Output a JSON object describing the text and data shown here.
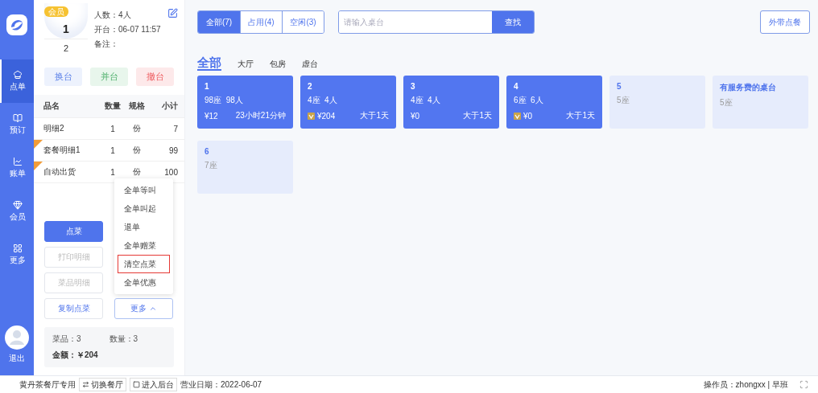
{
  "sidebar": {
    "items": [
      {
        "label": "点单",
        "kind": "order",
        "selected": true
      },
      {
        "label": "预订",
        "kind": "booking",
        "selected": false
      },
      {
        "label": "账单",
        "kind": "bill",
        "selected": false
      },
      {
        "label": "会员",
        "kind": "member",
        "selected": false
      },
      {
        "label": "更多",
        "kind": "more",
        "selected": false
      }
    ],
    "logout": "退出"
  },
  "current_table": {
    "badge": "会员",
    "number": "1",
    "guests": "2",
    "info": [
      "人数：4人",
      "开台：06-07 11:57",
      "备注："
    ]
  },
  "table_actions": [
    {
      "label": "换台",
      "kind": "change"
    },
    {
      "label": "并台",
      "kind": "merge"
    },
    {
      "label": "撤台",
      "kind": "cancel"
    }
  ],
  "order": {
    "columns": [
      "品名",
      "数量",
      "规格",
      "小计"
    ],
    "rows": [
      {
        "name": "明细2",
        "qty": "1",
        "unit": "份",
        "subtotal": "7",
        "set_meal": false
      },
      {
        "name": "套餐明细1",
        "qty": "1",
        "unit": "份",
        "subtotal": "99",
        "set_meal": true
      },
      {
        "name": "自动出货",
        "qty": "1",
        "unit": "份",
        "subtotal": "100",
        "set_meal": true
      }
    ]
  },
  "order_buttons": [
    {
      "label": "点菜",
      "kind": "primary",
      "disabled": false
    },
    {
      "label": "打印明细",
      "kind": "default",
      "disabled": true
    },
    {
      "label": "菜品明细",
      "kind": "default",
      "disabled": true
    },
    {
      "label": "复制点菜",
      "kind": "default",
      "disabled": false
    }
  ],
  "more_button": {
    "label": "更多",
    "expanded": true
  },
  "more_menu": [
    {
      "label": "全单等叫",
      "highlighted": false
    },
    {
      "label": "全单叫起",
      "highlighted": false
    },
    {
      "label": "退单",
      "highlighted": false
    },
    {
      "label": "全单赠菜",
      "highlighted": false
    },
    {
      "label": "清空点菜",
      "highlighted": true
    },
    {
      "label": "全单优惠",
      "highlighted": false
    }
  ],
  "summary": {
    "dishes": "菜品：3",
    "quantity": "数量：3",
    "amount": "金额：￥204"
  },
  "filters": [
    {
      "label": "全部(7)",
      "selected": true
    },
    {
      "label": "占用(4)",
      "selected": false
    },
    {
      "label": "空闲(3)",
      "selected": false
    }
  ],
  "search": {
    "placeholder": "请输入桌台",
    "button": "查找"
  },
  "takeout_button": "外带点餐",
  "regions": [
    {
      "label": "全部",
      "selected": true
    },
    {
      "label": "大厅",
      "selected": false
    },
    {
      "label": "包房",
      "selected": false
    },
    {
      "label": "虚台",
      "selected": false
    }
  ],
  "tables": [
    {
      "name": "1",
      "kind": "occupied",
      "seats": "98座",
      "people": "98人",
      "amount": "¥12",
      "duration": "23小时21分钟",
      "vip": false
    },
    {
      "name": "2",
      "kind": "occupied",
      "seats": "4座",
      "people": "4人",
      "amount": "¥204",
      "duration": "大于1天",
      "vip": true
    },
    {
      "name": "3",
      "kind": "occupied",
      "seats": "4座",
      "people": "4人",
      "amount": "¥0",
      "duration": "大于1天",
      "vip": false
    },
    {
      "name": "4",
      "kind": "occupied",
      "seats": "6座",
      "people": "6人",
      "amount": "¥0",
      "duration": "大于1天",
      "vip": true
    },
    {
      "name": "5",
      "kind": "free",
      "seats": "5座"
    },
    {
      "name": "有服务费的桌台",
      "kind": "free",
      "seats": "5座"
    },
    {
      "name": "6",
      "kind": "free",
      "seats": "7座"
    }
  ],
  "footer": {
    "restaurant": "黄丹茶餐厅专用",
    "switch_button": "切换餐厅",
    "backend_button": "进入后台",
    "business_date": "营业日期：2022-06-07",
    "operator": "操作员：zhongxx | 早班"
  }
}
